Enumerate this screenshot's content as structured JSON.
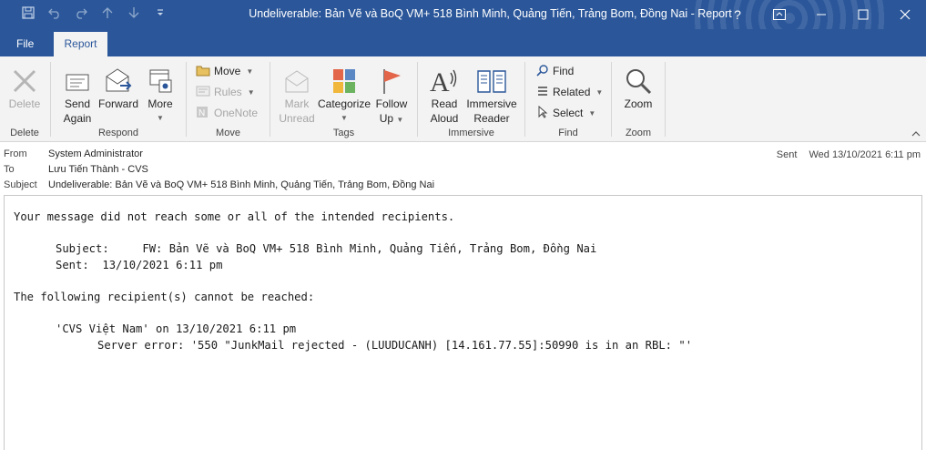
{
  "window": {
    "title": "Undeliverable: Bản Vẽ và BoQ VM+ 518 Bình Minh, Quảng Tiến, Trảng Bom, Đồng Nai  -  Report",
    "help": "?",
    "accent": "#2b579a"
  },
  "quick_access": [
    "save-icon",
    "undo-icon",
    "redo-icon",
    "up-arrow-icon",
    "down-arrow-icon",
    "customize-icon"
  ],
  "tabs": {
    "file": "File",
    "report": "Report"
  },
  "ribbon": {
    "delete_group": {
      "label": "Delete",
      "delete": "Delete"
    },
    "respond_group": {
      "label": "Respond",
      "send_again_1": "Send",
      "send_again_2": "Again",
      "forward": "Forward",
      "more": "More"
    },
    "move_group": {
      "label": "Move",
      "move": "Move",
      "rules": "Rules",
      "onenote": "OneNote"
    },
    "tags_group": {
      "label": "Tags",
      "mark_unread_1": "Mark",
      "mark_unread_2": "Unread",
      "categorize": "Categorize",
      "follow_up_1": "Follow",
      "follow_up_2": "Up"
    },
    "immersive_group": {
      "label": "Immersive",
      "read_aloud_1": "Read",
      "read_aloud_2": "Aloud",
      "immersive_reader_1": "Immersive",
      "immersive_reader_2": "Reader"
    },
    "find_group": {
      "label": "Find",
      "find": "Find",
      "related": "Related",
      "select": "Select"
    },
    "zoom_group": {
      "label": "Zoom",
      "zoom": "Zoom"
    }
  },
  "header": {
    "from_label": "From",
    "from_value": "System Administrator",
    "to_label": "To",
    "to_value": "Lưu Tiến Thành - CVS",
    "subject_label": "Subject",
    "subject_value": "Undeliverable: Bản Vẽ và BoQ VM+ 518 Bình Minh, Quảng Tiến, Trảng Bom, Đồng Nai",
    "sent_label": "Sent",
    "sent_value": "Wed 13/10/2021 6:11 pm"
  },
  "body": {
    "line1": "Your message did not reach some or all of the intended recipients.",
    "subject_line": "Subject:     FW: Bản Vẽ và BoQ VM+ 518 Bình Minh, Quảng Tiến, Trảng Bom, Đồng Nai",
    "sent_line": "Sent:  13/10/2021 6:11 pm",
    "line4": "The following recipient(s) cannot be reached:",
    "recipient_line": "'CVS Việt Nam' on 13/10/2021 6:11 pm",
    "error_line": "Server error: '550 \"JunkMail rejected - (LUUDUCANH) [14.161.77.55]:50990 is in an RBL: \"'"
  }
}
